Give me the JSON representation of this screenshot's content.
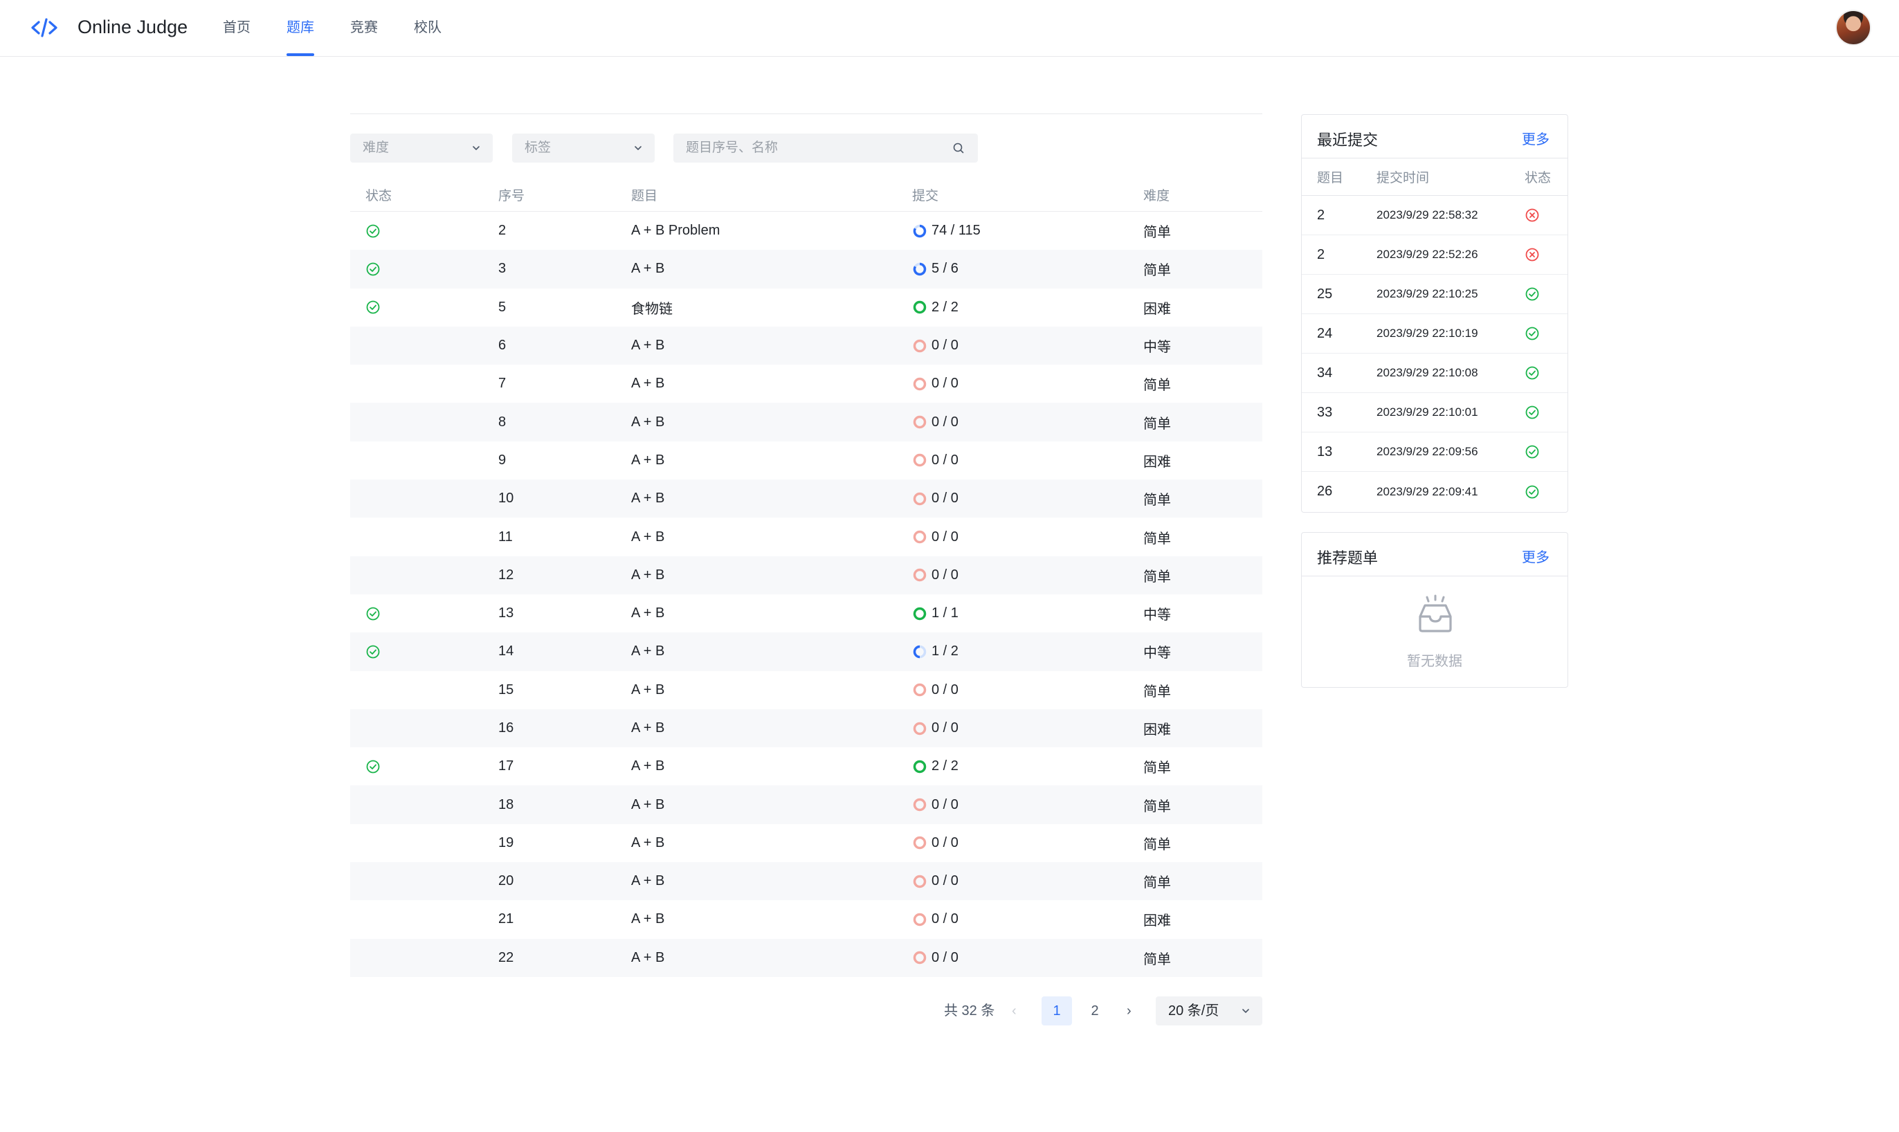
{
  "header": {
    "app_name": "Online Judge",
    "nav": [
      "首页",
      "题库",
      "竞赛",
      "校队"
    ],
    "active_nav": "题库"
  },
  "filters": {
    "difficulty_placeholder": "难度",
    "tag_placeholder": "标签",
    "search_placeholder": "题目序号、名称"
  },
  "table": {
    "headers": {
      "status": "状态",
      "id": "序号",
      "title": "题目",
      "submissions": "提交",
      "difficulty": "难度"
    },
    "rows": [
      {
        "solved": true,
        "id": "2",
        "title": "A + B Problem",
        "submissions": "74 / 115",
        "difficulty": "简单",
        "ring": "partial"
      },
      {
        "solved": true,
        "id": "3",
        "title": "A + B",
        "submissions": "5 / 6",
        "difficulty": "简单",
        "ring": "partial"
      },
      {
        "solved": true,
        "id": "5",
        "title": "食物链",
        "submissions": "2 / 2",
        "difficulty": "困难",
        "ring": "full"
      },
      {
        "solved": false,
        "id": "6",
        "title": "A + B",
        "submissions": "0 / 0",
        "difficulty": "中等",
        "ring": "none"
      },
      {
        "solved": false,
        "id": "7",
        "title": "A + B",
        "submissions": "0 / 0",
        "difficulty": "简单",
        "ring": "none"
      },
      {
        "solved": false,
        "id": "8",
        "title": "A + B",
        "submissions": "0 / 0",
        "difficulty": "简单",
        "ring": "none"
      },
      {
        "solved": false,
        "id": "9",
        "title": "A + B",
        "submissions": "0 / 0",
        "difficulty": "困难",
        "ring": "none"
      },
      {
        "solved": false,
        "id": "10",
        "title": "A + B",
        "submissions": "0 / 0",
        "difficulty": "简单",
        "ring": "none"
      },
      {
        "solved": false,
        "id": "11",
        "title": "A + B",
        "submissions": "0 / 0",
        "difficulty": "简单",
        "ring": "none"
      },
      {
        "solved": false,
        "id": "12",
        "title": "A + B",
        "submissions": "0 / 0",
        "difficulty": "简单",
        "ring": "none"
      },
      {
        "solved": true,
        "id": "13",
        "title": "A + B",
        "submissions": "1 / 1",
        "difficulty": "中等",
        "ring": "full"
      },
      {
        "solved": true,
        "id": "14",
        "title": "A + B",
        "submissions": "1 / 2",
        "difficulty": "中等",
        "ring": "half"
      },
      {
        "solved": false,
        "id": "15",
        "title": "A + B",
        "submissions": "0 / 0",
        "difficulty": "简单",
        "ring": "none"
      },
      {
        "solved": false,
        "id": "16",
        "title": "A + B",
        "submissions": "0 / 0",
        "difficulty": "困难",
        "ring": "none"
      },
      {
        "solved": true,
        "id": "17",
        "title": "A + B",
        "submissions": "2 / 2",
        "difficulty": "简单",
        "ring": "full"
      },
      {
        "solved": false,
        "id": "18",
        "title": "A + B",
        "submissions": "0 / 0",
        "difficulty": "简单",
        "ring": "none"
      },
      {
        "solved": false,
        "id": "19",
        "title": "A + B",
        "submissions": "0 / 0",
        "difficulty": "简单",
        "ring": "none"
      },
      {
        "solved": false,
        "id": "20",
        "title": "A + B",
        "submissions": "0 / 0",
        "difficulty": "简单",
        "ring": "none"
      },
      {
        "solved": false,
        "id": "21",
        "title": "A + B",
        "submissions": "0 / 0",
        "difficulty": "困难",
        "ring": "none"
      },
      {
        "solved": false,
        "id": "22",
        "title": "A + B",
        "submissions": "0 / 0",
        "difficulty": "简单",
        "ring": "none"
      }
    ]
  },
  "pagination": {
    "total": "共 32 条",
    "pages": [
      "1",
      "2"
    ],
    "current_page": "1",
    "page_size": "20 条/页"
  },
  "recent_submissions": {
    "title": "最近提交",
    "more": "更多",
    "headers": {
      "problem": "题目",
      "time": "提交时间",
      "status": "状态"
    },
    "rows": [
      {
        "problem": "2",
        "time": "2023/9/29 22:58:32",
        "status": "error"
      },
      {
        "problem": "2",
        "time": "2023/9/29 22:52:26",
        "status": "error"
      },
      {
        "problem": "25",
        "time": "2023/9/29 22:10:25",
        "status": "ok"
      },
      {
        "problem": "24",
        "time": "2023/9/29 22:10:19",
        "status": "ok"
      },
      {
        "problem": "34",
        "time": "2023/9/29 22:10:08",
        "status": "ok"
      },
      {
        "problem": "33",
        "time": "2023/9/29 22:10:01",
        "status": "ok"
      },
      {
        "problem": "13",
        "time": "2023/9/29 22:09:56",
        "status": "ok"
      },
      {
        "problem": "26",
        "time": "2023/9/29 22:09:41",
        "status": "ok"
      }
    ]
  },
  "recommended": {
    "title": "推荐题单",
    "more": "更多",
    "empty_text": "暂无数据"
  },
  "colors": {
    "accent": "#2b6cf6",
    "success": "#19b44a",
    "error": "#f04b4b",
    "empty_ring": "#f3a8a0",
    "partial_ring": "#2b6cf6"
  }
}
